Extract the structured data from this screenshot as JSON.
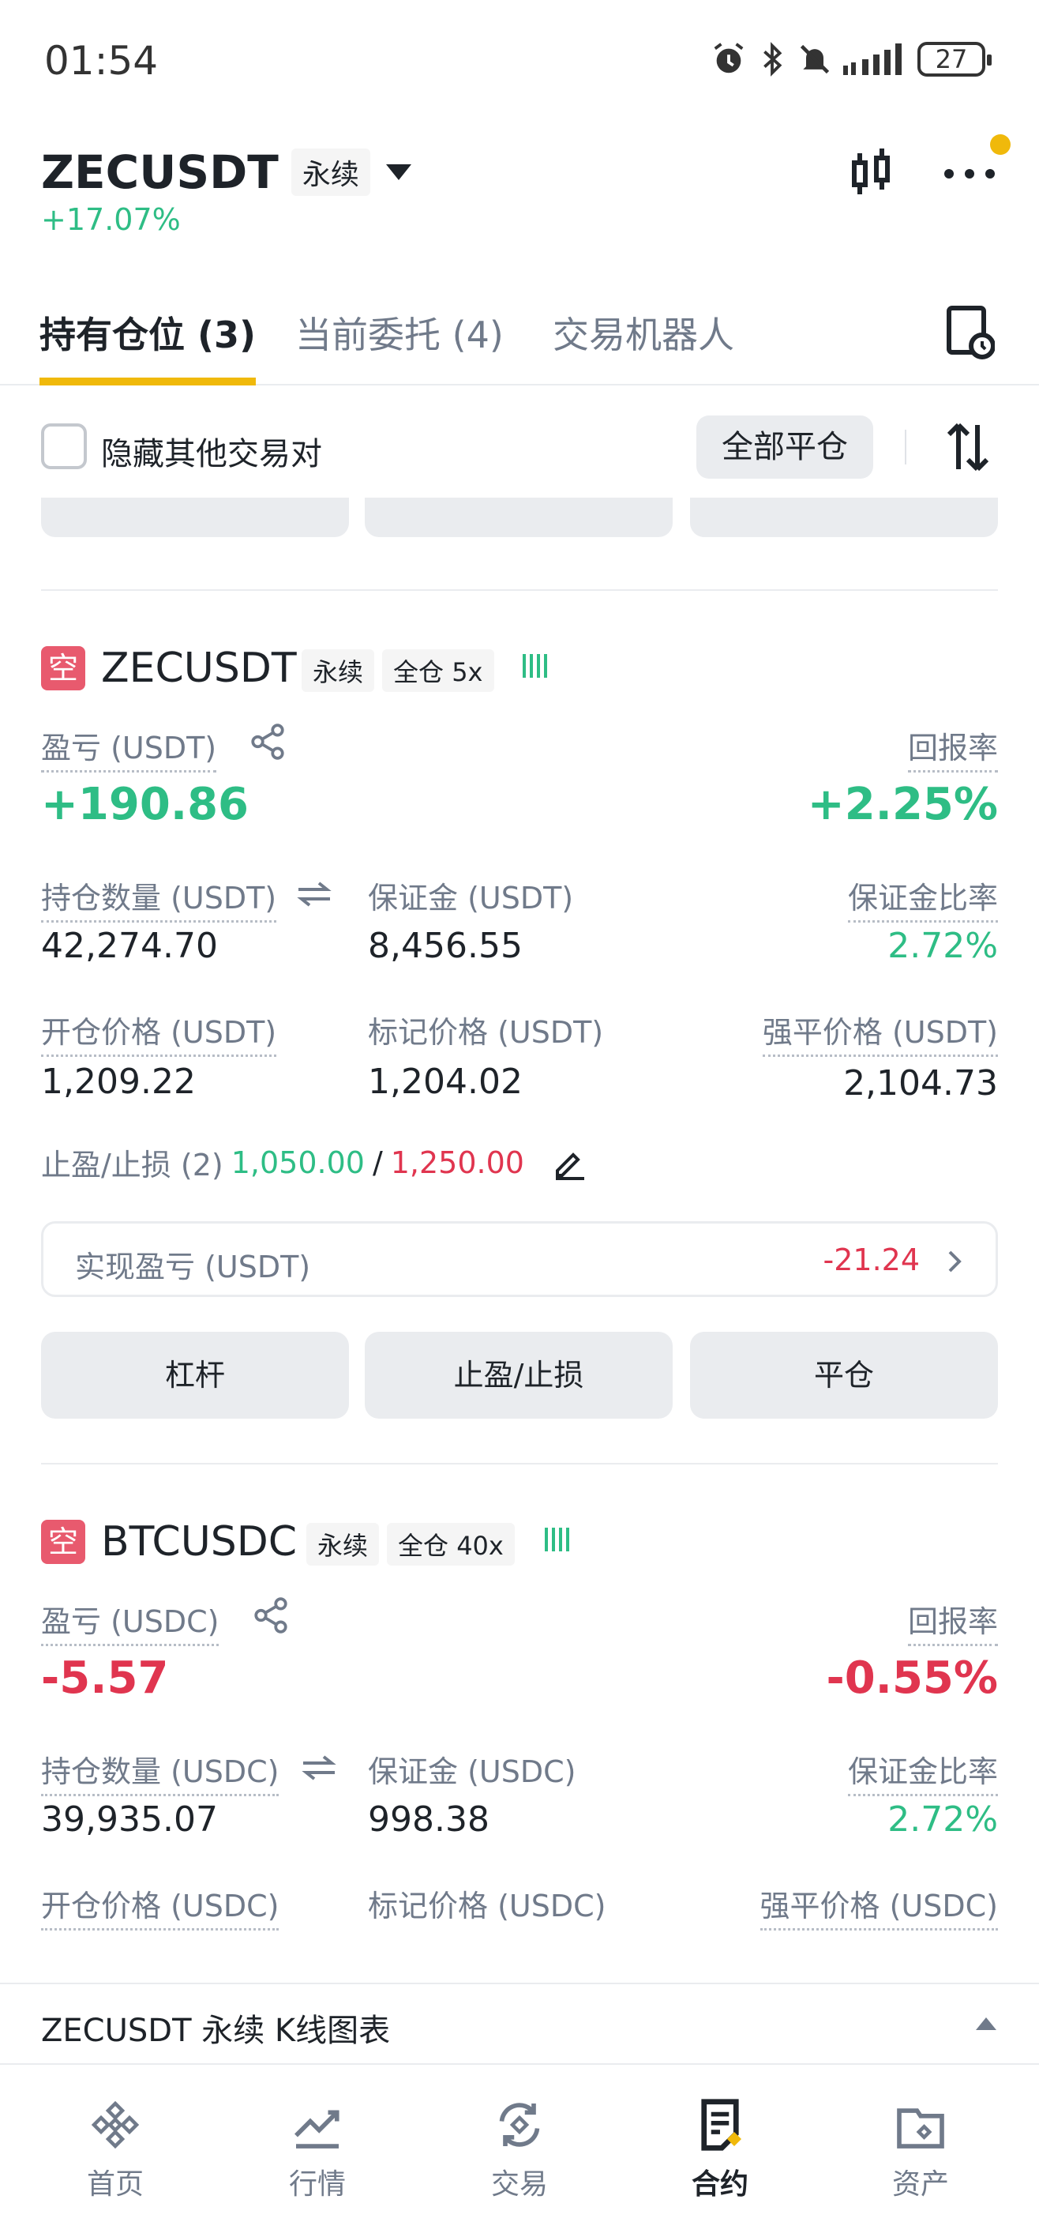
{
  "status_bar": {
    "time": "01:54",
    "battery": "27",
    "icons": [
      "alarm-icon",
      "bluetooth-icon",
      "bell-muted-icon",
      "signal-icon",
      "battery-icon"
    ]
  },
  "header": {
    "symbol": "ZECUSDT",
    "contract_tag": "永续",
    "change": "+17.07%",
    "accent_color": "#f0b90b",
    "green": "#2ebd85",
    "red": "#e0354f"
  },
  "tabs": [
    {
      "label": "持有仓位 (3)",
      "active": true
    },
    {
      "label": "当前委托 (4)",
      "active": false
    },
    {
      "label": "交易机器人",
      "active": false
    }
  ],
  "filter": {
    "hide_other_label": "隐藏其他交易对",
    "close_all_label": "全部平仓"
  },
  "positions": [
    {
      "side": "空",
      "symbol": "ZECUSDT",
      "contract_tag": "永续",
      "margin_tag": "全仓 5x",
      "pnl_label": "盈亏 (USDT)",
      "pnl": "+190.86",
      "roe_label": "回报率",
      "roe": "+2.25%",
      "size_label": "持仓数量 (USDT)",
      "size": "42,274.70",
      "margin_label": "保证金 (USDT)",
      "margin": "8,456.55",
      "margin_ratio_label": "保证金比率",
      "margin_ratio": "2.72%",
      "entry_label": "开仓价格 (USDT)",
      "entry": "1,209.22",
      "mark_label": "标记价格 (USDT)",
      "mark": "1,204.02",
      "liq_label": "强平价格 (USDT)",
      "liq": "2,104.73",
      "tpsl_label": "止盈/止损 (2)",
      "tp": "1,050.00",
      "sl": "1,250.00",
      "realized_label": "实现盈亏 (USDT)",
      "realized": "-21.24",
      "buttons": {
        "leverage": "杠杆",
        "tpsl": "止盈/止损",
        "close": "平仓"
      }
    },
    {
      "side": "空",
      "symbol": "BTCUSDC",
      "contract_tag": "永续",
      "margin_tag": "全仓 40x",
      "pnl_label": "盈亏 (USDC)",
      "pnl": "-5.57",
      "roe_label": "回报率",
      "roe": "-0.55%",
      "size_label": "持仓数量 (USDC)",
      "size": "39,935.07",
      "margin_label": "保证金 (USDC)",
      "margin": "998.38",
      "margin_ratio_label": "保证金比率",
      "margin_ratio": "2.72%",
      "entry_label": "开仓价格 (USDC)",
      "mark_label": "标记价格 (USDC)",
      "liq_label": "强平价格 (USDC)"
    }
  ],
  "kline_bar": {
    "label": "ZECUSDT 永续 K线图表"
  },
  "bottom_nav": [
    {
      "label": "首页",
      "active": false
    },
    {
      "label": "行情",
      "active": false
    },
    {
      "label": "交易",
      "active": false
    },
    {
      "label": "合约",
      "active": true
    },
    {
      "label": "资产",
      "active": false
    }
  ]
}
